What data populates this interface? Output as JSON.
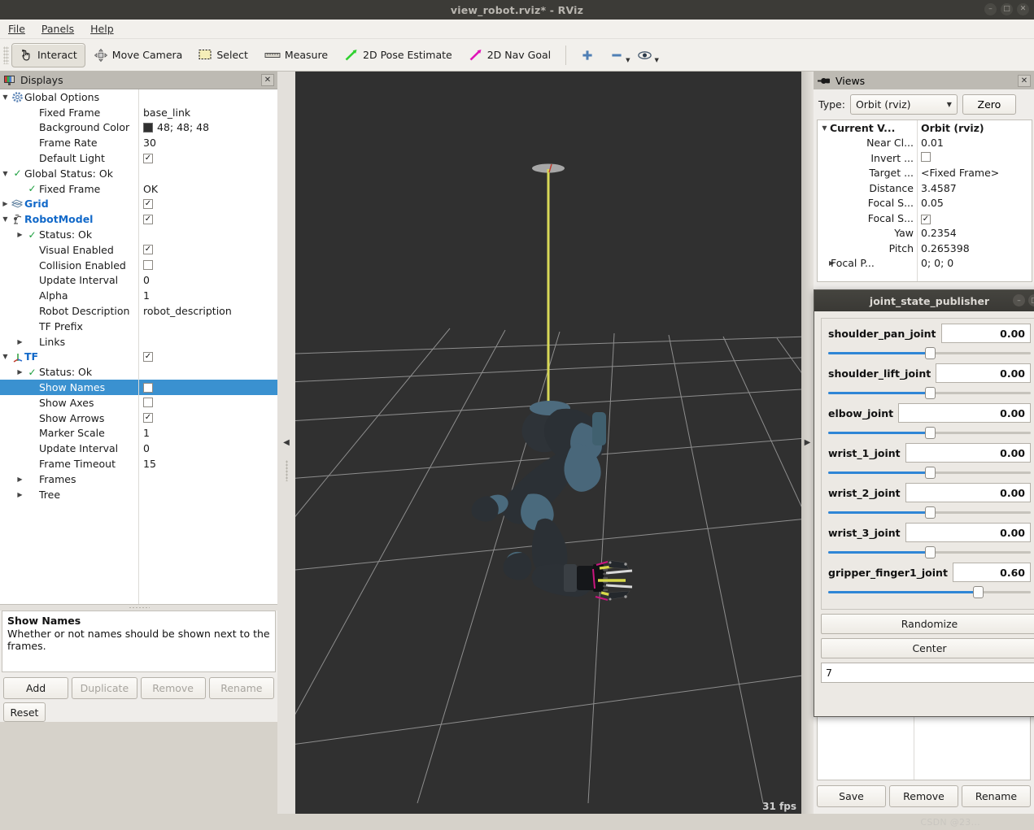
{
  "window": {
    "title": "view_robot.rviz* - RViz",
    "minimize": "–",
    "maximize": "□",
    "close": "✕"
  },
  "menubar": {
    "items": [
      "File",
      "Panels",
      "Help"
    ]
  },
  "toolbar": {
    "items": [
      {
        "label": "Interact",
        "icon": "hand-cursor-icon",
        "active": true
      },
      {
        "label": "Move Camera",
        "icon": "move-camera-icon",
        "active": false
      },
      {
        "label": "Select",
        "icon": "select-rect-icon",
        "active": false
      },
      {
        "label": "Measure",
        "icon": "ruler-icon",
        "active": false
      },
      {
        "label": "2D Pose Estimate",
        "icon": "green-arrow-icon",
        "active": false
      },
      {
        "label": "2D Nav Goal",
        "icon": "magenta-arrow-icon",
        "active": false
      }
    ],
    "plus_icon": "plus-icon",
    "minus_icon": "minus-icon",
    "eye_icon": "eye-icon"
  },
  "displays": {
    "title": "Displays",
    "close_label": "✕",
    "rows": [
      {
        "indent": 0,
        "twist": "▼",
        "icon": "gear",
        "label": "Global Options",
        "bold": false,
        "blue": false,
        "value_type": "none",
        "value": ""
      },
      {
        "indent": 1,
        "twist": "",
        "icon": "",
        "label": "Fixed Frame",
        "value_type": "text",
        "value": "base_link"
      },
      {
        "indent": 1,
        "twist": "",
        "icon": "",
        "label": "Background Color",
        "value_type": "color",
        "value": "48; 48; 48",
        "color": "#303030"
      },
      {
        "indent": 1,
        "twist": "",
        "icon": "",
        "label": "Frame Rate",
        "value_type": "text",
        "value": "30"
      },
      {
        "indent": 1,
        "twist": "",
        "icon": "",
        "label": "Default Light",
        "value_type": "check",
        "value": "✓"
      },
      {
        "indent": 0,
        "twist": "▼",
        "icon": "check",
        "label": "Global Status: Ok",
        "value_type": "none",
        "value": ""
      },
      {
        "indent": 1,
        "twist": "",
        "icon": "check",
        "label": "Fixed Frame",
        "value_type": "text",
        "value": "OK"
      },
      {
        "indent": 0,
        "twist": "▶",
        "icon": "grid",
        "label": "Grid",
        "blue": true,
        "value_type": "check",
        "value": "✓"
      },
      {
        "indent": 0,
        "twist": "▼",
        "icon": "robot",
        "label": "RobotModel",
        "blue": true,
        "value_type": "check",
        "value": "✓"
      },
      {
        "indent": 1,
        "twist": "▶",
        "icon": "check",
        "label": "Status: Ok",
        "value_type": "none",
        "value": ""
      },
      {
        "indent": 1,
        "twist": "",
        "icon": "",
        "label": "Visual Enabled",
        "value_type": "check",
        "value": "✓"
      },
      {
        "indent": 1,
        "twist": "",
        "icon": "",
        "label": "Collision Enabled",
        "value_type": "check",
        "value": ""
      },
      {
        "indent": 1,
        "twist": "",
        "icon": "",
        "label": "Update Interval",
        "value_type": "text",
        "value": "0"
      },
      {
        "indent": 1,
        "twist": "",
        "icon": "",
        "label": "Alpha",
        "value_type": "text",
        "value": "1"
      },
      {
        "indent": 1,
        "twist": "",
        "icon": "",
        "label": "Robot Description",
        "value_type": "text",
        "value": "robot_description"
      },
      {
        "indent": 1,
        "twist": "",
        "icon": "",
        "label": "TF Prefix",
        "value_type": "none",
        "value": ""
      },
      {
        "indent": 1,
        "twist": "▶",
        "icon": "",
        "label": "Links",
        "value_type": "none",
        "value": ""
      },
      {
        "indent": 0,
        "twist": "▼",
        "icon": "tf",
        "label": "TF",
        "blue": true,
        "value_type": "check",
        "value": "✓"
      },
      {
        "indent": 1,
        "twist": "▶",
        "icon": "check",
        "label": "Status: Ok",
        "value_type": "none",
        "value": ""
      },
      {
        "indent": 1,
        "twist": "",
        "icon": "",
        "label": "Show Names",
        "selected": true,
        "value_type": "check",
        "value": ""
      },
      {
        "indent": 1,
        "twist": "",
        "icon": "",
        "label": "Show Axes",
        "value_type": "check",
        "value": ""
      },
      {
        "indent": 1,
        "twist": "",
        "icon": "",
        "label": "Show Arrows",
        "value_type": "check",
        "value": "✓"
      },
      {
        "indent": 1,
        "twist": "",
        "icon": "",
        "label": "Marker Scale",
        "value_type": "text",
        "value": "1"
      },
      {
        "indent": 1,
        "twist": "",
        "icon": "",
        "label": "Update Interval",
        "value_type": "text",
        "value": "0"
      },
      {
        "indent": 1,
        "twist": "",
        "icon": "",
        "label": "Frame Timeout",
        "value_type": "text",
        "value": "15"
      },
      {
        "indent": 1,
        "twist": "▶",
        "icon": "",
        "label": "Frames",
        "value_type": "none",
        "value": ""
      },
      {
        "indent": 1,
        "twist": "▶",
        "icon": "",
        "label": "Tree",
        "value_type": "none",
        "value": ""
      }
    ],
    "help": {
      "title": "Show Names",
      "text": "Whether or not names should be shown next to the frames."
    },
    "buttons": [
      {
        "label": "Add",
        "enabled": true
      },
      {
        "label": "Duplicate",
        "enabled": false
      },
      {
        "label": "Remove",
        "enabled": false
      },
      {
        "label": "Rename",
        "enabled": false
      }
    ],
    "reset_label": "Reset"
  },
  "view3d": {
    "fps": "31 fps",
    "background_color": "#303030",
    "grid_color": "#b4b4b4"
  },
  "views_panel": {
    "title": "Views",
    "close_label": "✕",
    "type_label": "Type:",
    "type_value": "Orbit (rviz)",
    "zero_label": "Zero",
    "rows": [
      {
        "lead": true,
        "twist": "▼",
        "name": "Current V...",
        "value": "Orbit (rviz)",
        "bold": true,
        "value_type": "text"
      },
      {
        "lead": false,
        "twist": "",
        "name": "Near Cl...",
        "value": "0.01",
        "value_type": "text"
      },
      {
        "lead": false,
        "twist": "",
        "name": "Invert ...",
        "value": "",
        "value_type": "check"
      },
      {
        "lead": false,
        "twist": "",
        "name": "Target ...",
        "value": "<Fixed Frame>",
        "value_type": "text"
      },
      {
        "lead": false,
        "twist": "",
        "name": "Distance",
        "value": "3.4587",
        "value_type": "text"
      },
      {
        "lead": false,
        "twist": "",
        "name": "Focal S...",
        "value": "0.05",
        "value_type": "text"
      },
      {
        "lead": false,
        "twist": "",
        "name": "Focal S...",
        "value": "✓",
        "value_type": "check"
      },
      {
        "lead": false,
        "twist": "",
        "name": "Yaw",
        "value": "0.2354",
        "value_type": "text"
      },
      {
        "lead": false,
        "twist": "",
        "name": "Pitch",
        "value": "0.265398",
        "value_type": "text"
      },
      {
        "lead": true,
        "twist": "▶",
        "name": "Focal P...",
        "value": "0; 0; 0",
        "value_type": "text"
      }
    ],
    "bottom_buttons": [
      "Save",
      "Remove",
      "Rename"
    ]
  },
  "joint_state_publisher": {
    "title": "joint_state_publisher",
    "minimize": "–",
    "maximize": "□",
    "joints": [
      {
        "name": "shoulder_pan_joint",
        "value": "0.00",
        "pct": 50
      },
      {
        "name": "shoulder_lift_joint",
        "value": "0.00",
        "pct": 50
      },
      {
        "name": "elbow_joint",
        "value": "0.00",
        "pct": 50
      },
      {
        "name": "wrist_1_joint",
        "value": "0.00",
        "pct": 50
      },
      {
        "name": "wrist_2_joint",
        "value": "0.00",
        "pct": 50
      },
      {
        "name": "wrist_3_joint",
        "value": "0.00",
        "pct": 50
      },
      {
        "name": "gripper_finger1_joint",
        "value": "0.60",
        "pct": 74
      }
    ],
    "randomize_label": "Randomize",
    "center_label": "Center",
    "field_value": "7"
  },
  "watermark": "CSDN @23..."
}
